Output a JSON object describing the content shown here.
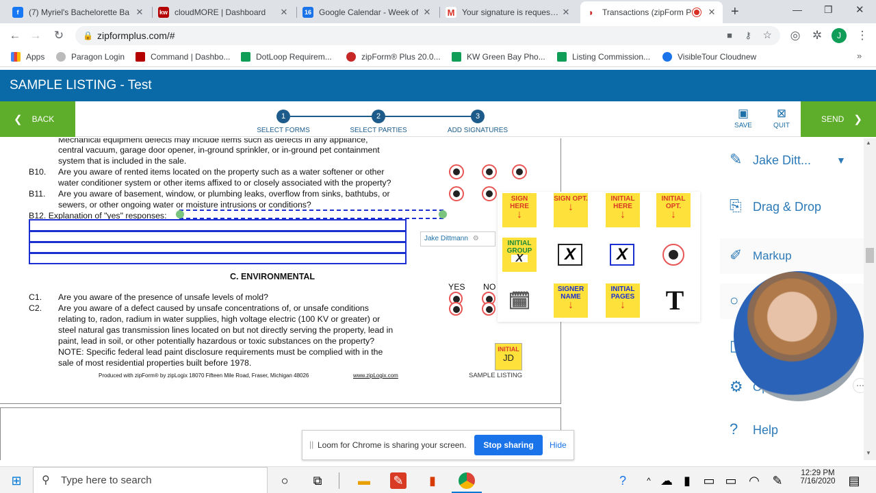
{
  "browser": {
    "tabs": [
      {
        "title": "(7) Myriel's Bachelorette Ba",
        "icon": "facebook-icon",
        "color": "#1877f2"
      },
      {
        "title": "cloudMORE | Dashboard",
        "icon": "kw-icon",
        "color": "#b40101"
      },
      {
        "title": "Google Calendar - Week of",
        "icon": "calendar-icon",
        "color": "#1a73e8"
      },
      {
        "title": "Your signature is requested",
        "icon": "gmail-icon",
        "color": "#d93025"
      },
      {
        "title": "Transactions (zipForm P",
        "icon": "zipform-icon",
        "color": "#c62828"
      }
    ],
    "url": "zipformplus.com/#",
    "bookmarks": [
      {
        "label": "Apps",
        "color": "#4285f4"
      },
      {
        "label": "Paragon Login",
        "color": "#777777"
      },
      {
        "label": "Command | Dashbo...",
        "color": "#b40101"
      },
      {
        "label": "DotLoop Requirem...",
        "color": "#0f9d58"
      },
      {
        "label": "zipForm® Plus 20.0...",
        "color": "#c62828"
      },
      {
        "label": "KW Green Bay Pho...",
        "color": "#0f9d58"
      },
      {
        "label": "Listing Commission...",
        "color": "#0f9d58"
      },
      {
        "label": "VisibleTour Cloudnew",
        "color": "#1a73e8"
      }
    ],
    "profile_initial": "J"
  },
  "app": {
    "title": "SAMPLE LISTING - Test",
    "back_label": "BACK",
    "send_label": "SEND",
    "steps": [
      {
        "num": "1",
        "label": "SELECT FORMS"
      },
      {
        "num": "2",
        "label": "SELECT PARTIES"
      },
      {
        "num": "3",
        "label": "ADD SIGNATURES"
      }
    ],
    "save_label": "SAVE",
    "quit_label": "QUIT"
  },
  "document": {
    "lines_b": [
      "Mechanical equipment defects may include items such as defects in any appliance,",
      "central vacuum, garage door opener, in-ground sprinkler, or in-ground pet containment",
      "system that is included in the sale."
    ],
    "b10_num": "B10.",
    "b10": [
      "Are you aware of rented items located on the property such as a water softener or other",
      "water conditioner system or other items affixed to or closely associated with the property?"
    ],
    "b11_num": "B11.",
    "b11": [
      "Are you aware of basement, window, or plumbing leaks, overflow from sinks, bathtubs, or",
      "sewers, or other ongoing water or moisture intrusions or conditions?"
    ],
    "b12": "B12.  Explanation of \"yes\" responses:",
    "signer_field": "Jake Dittmann",
    "section_c": "C.   ENVIRONMENTAL",
    "yes": "YES",
    "no": "NO",
    "c1_num": "C1.",
    "c1": "Are you aware of the presence of unsafe levels of mold?",
    "c2_num": "C2.",
    "c2": [
      "Are you aware of a defect caused by unsafe concentrations of, or unsafe conditions",
      "relating to, radon, radium in water supplies, high voltage electric (100 KV or greater) or",
      "steel natural gas transmission lines located on but not directly serving the property, lead in",
      "paint, lead in soil, or other potentially hazardous or toxic substances on the property?",
      "NOTE: Specific federal lead paint disclosure requirements must be complied with in the",
      "sale of most residential properties built before 1978."
    ],
    "footer": "Produced with zipForm® by zipLogix  18070 Fifteen Mile Road, Fraser, Michigan 48026",
    "footer_link": "www.zipLogix.com",
    "initial_label": "INITIAL",
    "initial_value": "JD",
    "listing_label": "SAMPLE LISTING"
  },
  "palette": {
    "items": [
      {
        "label": "SIGN HERE"
      },
      {
        "label": "SIGN OPT."
      },
      {
        "label": "INITIAL HERE"
      },
      {
        "label": "INITIAL OPT."
      },
      {
        "label": "INITIAL GROUP"
      },
      {
        "label": "SIGNER NAME"
      },
      {
        "label": "INITIAL PAGES"
      }
    ],
    "x_glyph": "X",
    "text_glyph": "T"
  },
  "right_panel": {
    "signer": "Jake Ditt...",
    "drag_drop": "Drag & Drop",
    "markup": "Markup",
    "options_partial": "Op",
    "help": "Help"
  },
  "loom": {
    "message": "Loom for Chrome is sharing your screen.",
    "stop_label": "Stop sharing",
    "hide_label": "Hide"
  },
  "taskbar": {
    "search_placeholder": "Type here to search",
    "time": "12:29 PM",
    "date": "7/16/2020"
  }
}
